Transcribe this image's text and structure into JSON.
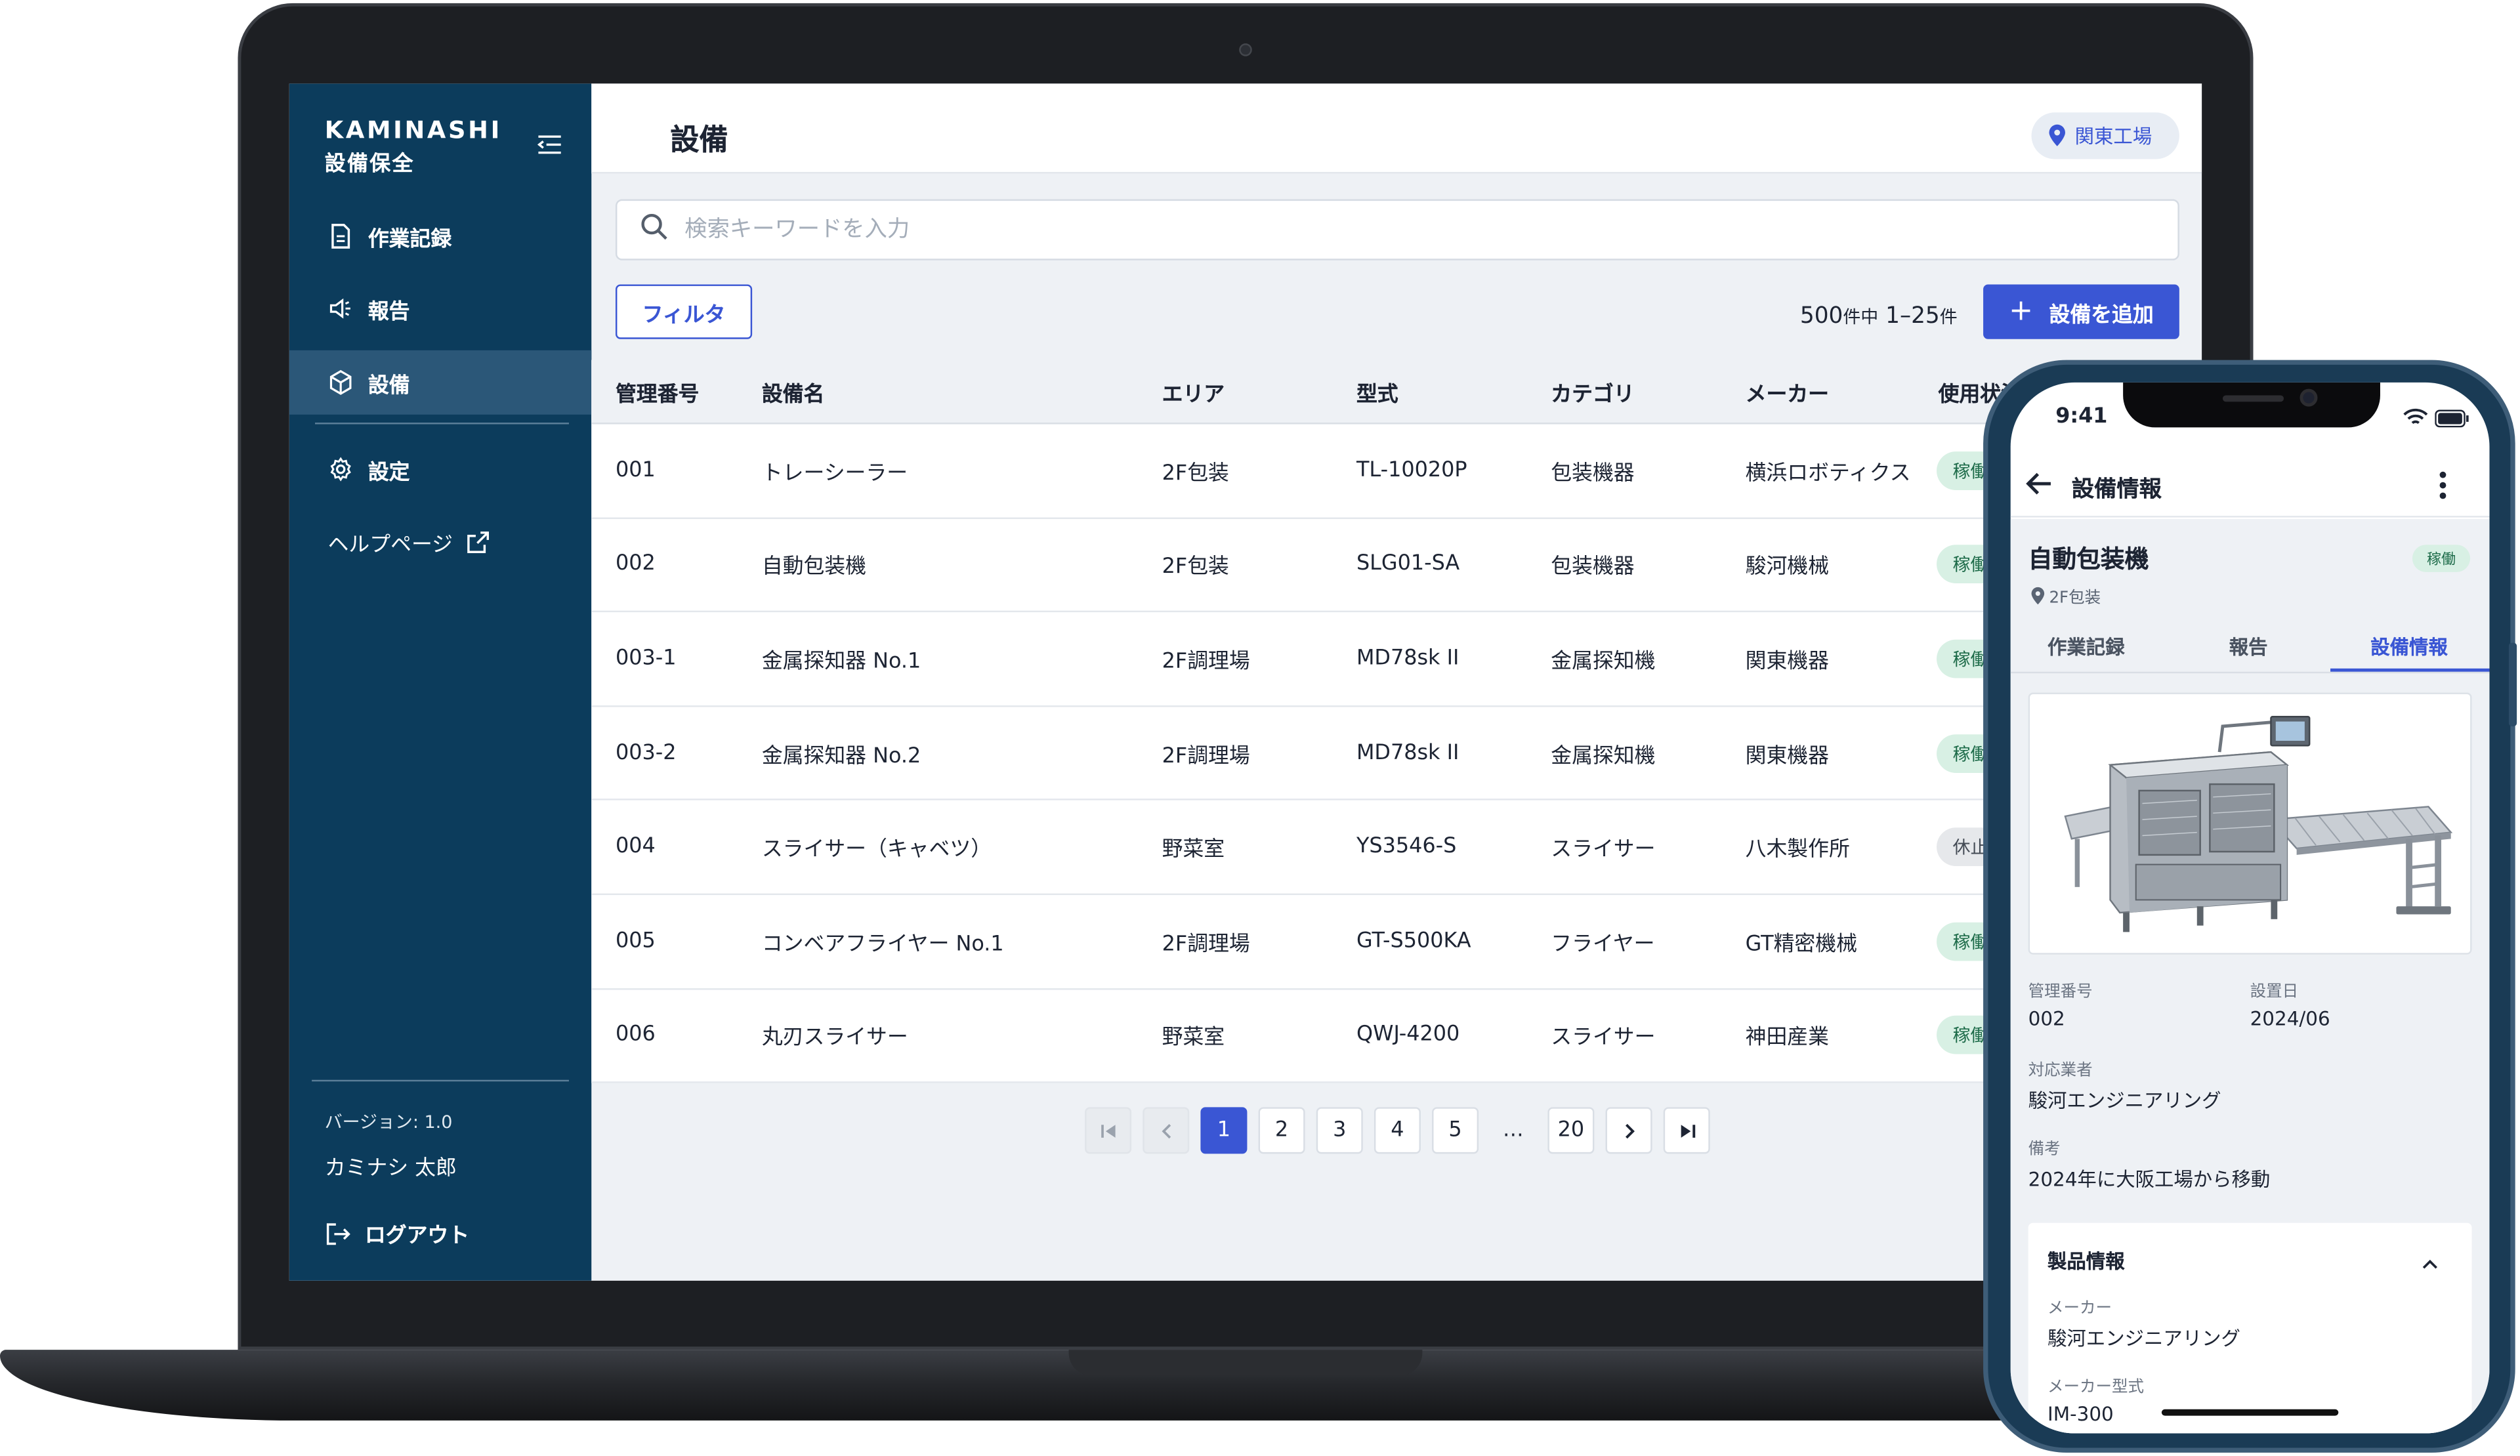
{
  "brand": {
    "name": "KAMINASHI",
    "subtitle": "設備保全"
  },
  "sidebar": {
    "items": [
      {
        "label": "作業記録",
        "icon": "document-icon"
      },
      {
        "label": "報告",
        "icon": "megaphone-icon"
      },
      {
        "label": "設備",
        "icon": "cube-icon",
        "active": true
      },
      {
        "label": "設定",
        "icon": "gear-icon"
      },
      {
        "label": "ヘルプページ",
        "icon": "external-link-icon"
      }
    ],
    "version": "バージョン: 1.0",
    "user": "カミナシ 太郎",
    "logout": "ログアウト"
  },
  "header": {
    "title": "設備",
    "location": "関東工場"
  },
  "search": {
    "placeholder": "検索キーワードを入力"
  },
  "toolbar": {
    "filter_label": "フィルタ",
    "count_total": "500",
    "count_unit1": "件中",
    "count_range": "1–25",
    "count_unit2": "件",
    "add_label": "設備を追加"
  },
  "table": {
    "columns": [
      "管理番号",
      "設備名",
      "エリア",
      "型式",
      "カテゴリ",
      "メーカー",
      "使用状況"
    ],
    "rows": [
      {
        "id": "001",
        "name": "トレーシーラー",
        "area": "2F包装",
        "model": "TL-10020P",
        "category": "包装機器",
        "maker": "横浜ロボティクス",
        "status": "稼働"
      },
      {
        "id": "002",
        "name": "自動包装機",
        "area": "2F包装",
        "model": "SLG01-SA",
        "category": "包装機器",
        "maker": "駿河機械",
        "status": "稼働"
      },
      {
        "id": "003-1",
        "name": "金属探知器 No.1",
        "area": "2F調理場",
        "model": "MD78sk II",
        "category": "金属探知機",
        "maker": "関東機器",
        "status": "稼働"
      },
      {
        "id": "003-2",
        "name": "金属探知器 No.2",
        "area": "2F調理場",
        "model": "MD78sk II",
        "category": "金属探知機",
        "maker": "関東機器",
        "status": "稼働"
      },
      {
        "id": "004",
        "name": "スライサー（キャベツ）",
        "area": "野菜室",
        "model": "YS3546-S",
        "category": "スライサー",
        "maker": "八木製作所",
        "status": "休止"
      },
      {
        "id": "005",
        "name": "コンベアフライヤー No.1",
        "area": "2F調理場",
        "model": "GT-S500KA",
        "category": "フライヤー",
        "maker": "GT精密機械",
        "status": "稼働"
      },
      {
        "id": "006",
        "name": "丸刃スライサー",
        "area": "野菜室",
        "model": "QWJ-4200",
        "category": "スライサー",
        "maker": "神田産業",
        "status": "稼働"
      }
    ]
  },
  "pagination": {
    "pages": [
      "1",
      "2",
      "3",
      "4",
      "5"
    ],
    "ellipsis": "…",
    "last": "20",
    "current": "1"
  },
  "phone": {
    "time": "9:41",
    "title": "設備情報",
    "equipment_name": "自動包装機",
    "status": "稼働",
    "area": "2F包装",
    "tabs": [
      "作業記録",
      "報告",
      "設備情報"
    ],
    "active_tab": "設備情報",
    "fields": {
      "id_label": "管理番号",
      "id_value": "002",
      "installed_label": "設置日",
      "installed_value": "2024/06",
      "vendor_label": "対応業者",
      "vendor_value": "駿河エンジニアリング",
      "note_label": "備考",
      "note_value": "2024年に大阪工場から移動"
    },
    "product": {
      "title": "製品情報",
      "maker_label": "メーカー",
      "maker_value": "駿河エンジニアリング",
      "model_label": "メーカー型式",
      "model_value": "IM-300"
    }
  }
}
